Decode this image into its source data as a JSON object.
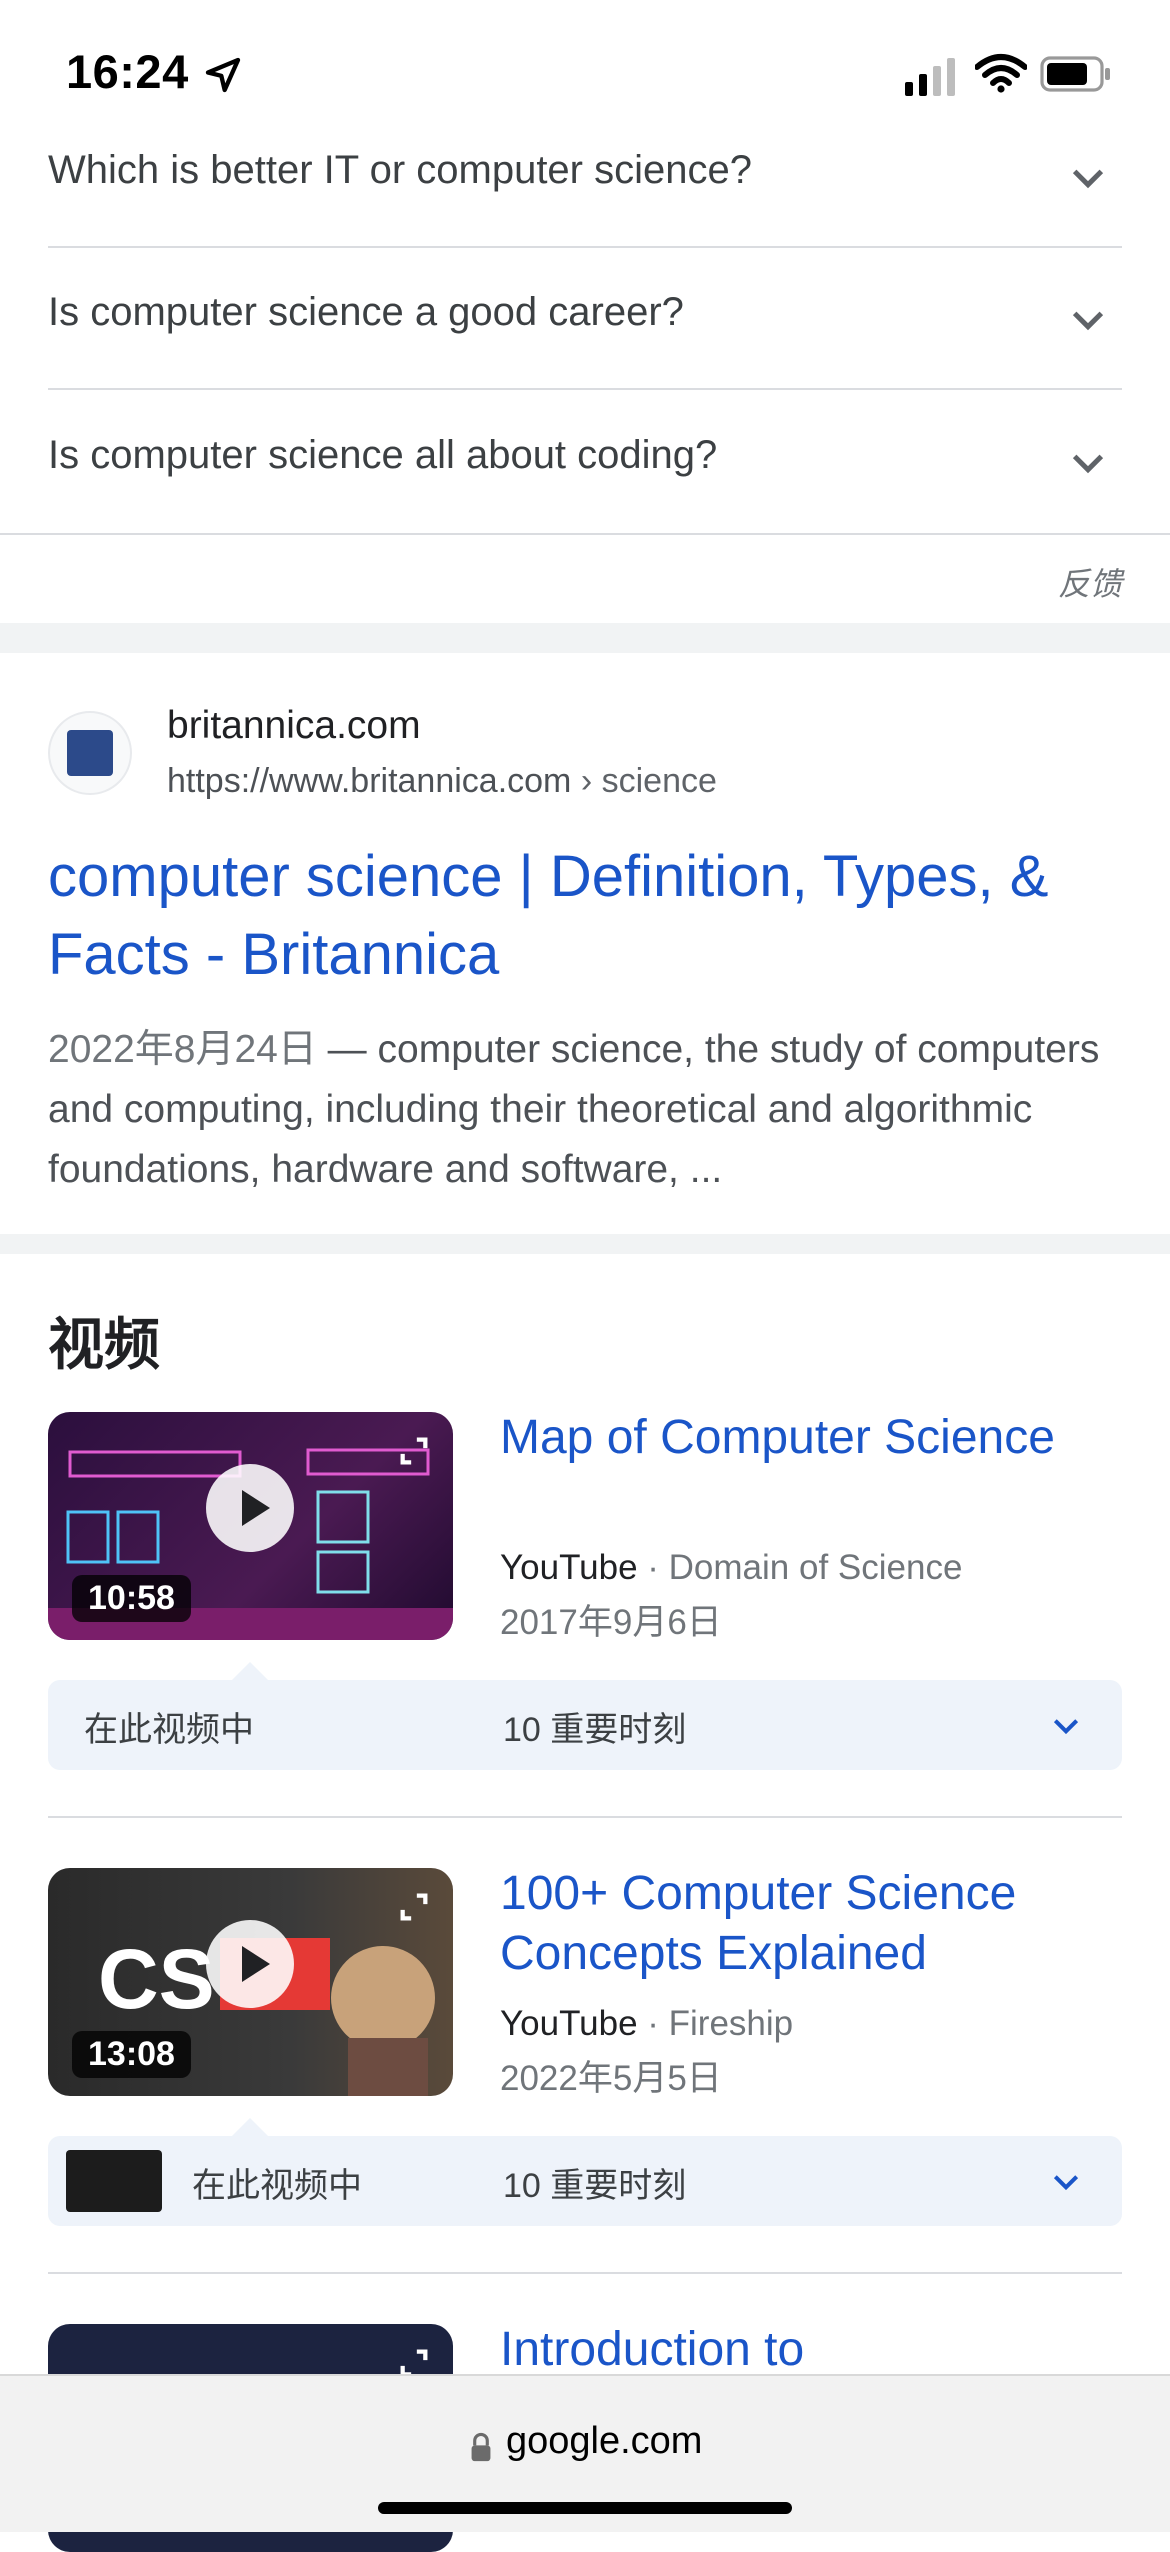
{
  "status_bar": {
    "time": "16:24"
  },
  "faq": {
    "items": [
      {
        "question": "Which is better IT or computer science?"
      },
      {
        "question": "Is computer science a good career?"
      },
      {
        "question": "Is computer science all about coding?"
      }
    ],
    "feedback": "反馈"
  },
  "result": {
    "site_name": "britannica.com",
    "url": "https://www.britannica.com",
    "breadcrumb": " › science",
    "title": "computer science | Definition, Types, & Facts - Britannica",
    "date": "2022年8月24日",
    "snippet": " — computer science, the study of computers and computing, including their theoretical and algorithmic foundations, hardware and software, ..."
  },
  "videos": {
    "heading": "视频",
    "items": [
      {
        "title": "Map of Computer Science",
        "platform": "YouTube",
        "channel": " · Domain of Science",
        "date": "2017年9月6日",
        "duration": "10:58",
        "moments_label": "在此视频中",
        "moments_count": "10 重要时刻"
      },
      {
        "title": "100+ Computer Science Concepts Explained",
        "platform": "YouTube",
        "channel": " · Fireship",
        "date": "2022年5月5日",
        "duration": "13:08",
        "moments_label": "在此视频中",
        "moments_count": "10 重要时刻"
      },
      {
        "title": "Introduction to"
      }
    ]
  },
  "browser": {
    "domain": "google.com"
  },
  "colors": {
    "link": "#1a55c8",
    "divider": "#dadce0",
    "moments_bg": "#eef3fa"
  }
}
